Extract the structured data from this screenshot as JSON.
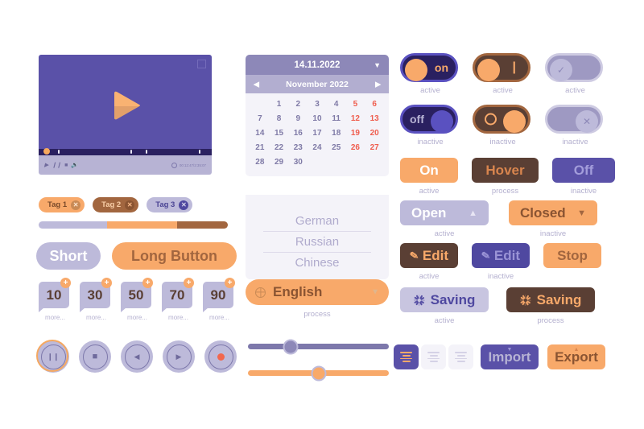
{
  "colors": {
    "orange": "#f8a96a",
    "purple": "#5a51a8",
    "deep_navy": "#2a2060",
    "brown": "#5a3f34",
    "tan": "#a2663f",
    "lavender": "#bdbada",
    "light_bg": "#f4f3f9",
    "red": "#ef5d4e"
  },
  "video_player": {
    "name": "video-player",
    "play_icon": "play-triangle-icon",
    "fullscreen_icon": "fullscreen-icon",
    "controls": [
      "play-icon",
      "pause-icon",
      "stop-icon",
      "volume-icon"
    ],
    "settings_icon": "gear-icon",
    "time": "00:12:47/2:35:07",
    "progress_percent": 4,
    "tick_positions": [
      4,
      18,
      62,
      71,
      96
    ]
  },
  "tags": [
    {
      "label": "Tag 1",
      "close_icon": "close-icon",
      "style": "tag1"
    },
    {
      "label": "Tag 2",
      "close_icon": "close-icon",
      "style": "tag2"
    },
    {
      "label": "Tag 3",
      "close_icon": "close-icon",
      "style": "tag3"
    }
  ],
  "segmented_bar": {
    "name": "segmented-progress-bar",
    "segments": [
      {
        "color": "#bdbada",
        "percent": 36
      },
      {
        "color": "#f8a96a",
        "percent": 37
      },
      {
        "color": "#a2663f",
        "percent": 27
      }
    ]
  },
  "pill_buttons": [
    {
      "label": "Short",
      "style": "pill-short"
    },
    {
      "label": "Long Button",
      "style": "pill-long"
    }
  ],
  "counters": [
    {
      "value": "10",
      "badge": "+",
      "caption": "more..."
    },
    {
      "value": "30",
      "badge": "+",
      "caption": "more..."
    },
    {
      "value": "50",
      "badge": "+",
      "caption": "more..."
    },
    {
      "value": "70",
      "badge": "+",
      "caption": "more..."
    },
    {
      "value": "90",
      "badge": "+",
      "caption": "more..."
    }
  ],
  "media_buttons": [
    {
      "icon": "pause-icon",
      "glyph": "❙❙",
      "highlighted": true
    },
    {
      "icon": "stop-icon",
      "glyph": "■",
      "highlighted": false
    },
    {
      "icon": "rewind-icon",
      "glyph": "◀",
      "highlighted": false
    },
    {
      "icon": "play-icon",
      "glyph": "▶",
      "highlighted": false
    },
    {
      "icon": "record-icon",
      "glyph": "",
      "highlighted": false
    }
  ],
  "calendar": {
    "name": "date-picker",
    "selected_date": "14.11.2022",
    "dropdown_icon": "chevron-down-icon",
    "month_label": "November 2022",
    "prev_icon": "chevron-left-icon",
    "next_icon": "chevron-right-icon",
    "leading_blank_days": 1,
    "days": [
      {
        "n": "1",
        "weekend": false
      },
      {
        "n": "2",
        "weekend": false
      },
      {
        "n": "3",
        "weekend": false
      },
      {
        "n": "4",
        "weekend": false
      },
      {
        "n": "5",
        "weekend": true
      },
      {
        "n": "6",
        "weekend": true
      },
      {
        "n": "7",
        "weekend": false
      },
      {
        "n": "8",
        "weekend": false
      },
      {
        "n": "9",
        "weekend": false
      },
      {
        "n": "10",
        "weekend": false
      },
      {
        "n": "11",
        "weekend": false
      },
      {
        "n": "12",
        "weekend": true
      },
      {
        "n": "13",
        "weekend": true
      },
      {
        "n": "14",
        "weekend": false
      },
      {
        "n": "15",
        "weekend": false
      },
      {
        "n": "16",
        "weekend": false
      },
      {
        "n": "17",
        "weekend": false
      },
      {
        "n": "18",
        "weekend": false
      },
      {
        "n": "19",
        "weekend": true
      },
      {
        "n": "20",
        "weekend": true
      },
      {
        "n": "21",
        "weekend": false
      },
      {
        "n": "22",
        "weekend": false
      },
      {
        "n": "23",
        "weekend": false
      },
      {
        "n": "24",
        "weekend": false
      },
      {
        "n": "25",
        "weekend": false
      },
      {
        "n": "26",
        "weekend": true
      },
      {
        "n": "27",
        "weekend": true
      },
      {
        "n": "28",
        "weekend": false
      },
      {
        "n": "29",
        "weekend": false
      },
      {
        "n": "30",
        "weekend": false
      }
    ]
  },
  "language_select": {
    "name": "language-dropdown",
    "globe_icon": "globe-icon",
    "selected": "English",
    "dropdown_icon": "chevron-down-icon",
    "options": [
      "German",
      "Russian",
      "Chinese"
    ],
    "caption": "process"
  },
  "sliders": [
    {
      "name": "slider-purple",
      "value_percent": 30,
      "track_color": "#7d78ab"
    },
    {
      "name": "slider-orange",
      "value_percent": 50,
      "track_color": "#f8a96a"
    }
  ],
  "toggles": [
    {
      "name": "toggle-on-dark",
      "label": "on",
      "caption": "active",
      "style": "tg-on"
    },
    {
      "name": "toggle-on-brown",
      "label": "|",
      "caption": "active",
      "style": "tg-br-on"
    },
    {
      "name": "toggle-check-gray",
      "label": "",
      "caption": "active",
      "style": "tg-gr",
      "icon": "check-icon"
    },
    {
      "name": "toggle-off-dark",
      "label": "off",
      "caption": "inactive",
      "style": "tg-off"
    },
    {
      "name": "toggle-off-brown",
      "label": "",
      "caption": "inactive",
      "style": "tg-br-off",
      "icon": "circle-icon"
    },
    {
      "name": "toggle-x-gray",
      "label": "",
      "caption": "inactive",
      "style": "tg-gr2",
      "icon": "close-icon"
    }
  ],
  "state_buttons": [
    {
      "name": "button-on",
      "label": "On",
      "caption": "active",
      "style": "b-on"
    },
    {
      "name": "button-hover",
      "label": "Hover",
      "caption": "process",
      "style": "b-hover"
    },
    {
      "name": "button-off",
      "label": "Off",
      "caption": "inactive",
      "style": "b-off"
    }
  ],
  "disclosure_buttons": [
    {
      "name": "button-open",
      "label": "Open",
      "caption": "active",
      "style": "b-open",
      "icon": "chevron-up-icon",
      "glyph": "▲"
    },
    {
      "name": "button-closed",
      "label": "Closed",
      "caption": "inactive",
      "style": "b-closed",
      "icon": "chevron-down-icon",
      "glyph": "▼"
    }
  ],
  "edit_buttons": [
    {
      "name": "button-edit-active",
      "label": "Edit",
      "caption": "active",
      "style": "b-edit-a",
      "icon": "pencil-icon"
    },
    {
      "name": "button-edit-inactive",
      "label": "Edit",
      "caption": "inactive",
      "style": "b-edit-i",
      "icon": "pencil-icon"
    },
    {
      "name": "button-stop",
      "label": "Stop",
      "caption": "",
      "style": "b-stop",
      "icon": ""
    }
  ],
  "saving_buttons": [
    {
      "name": "button-saving-active",
      "label": "Saving",
      "caption": "active",
      "style": "b-save-a",
      "icon": "spinner-icon",
      "spinner_color": "#4f48a0"
    },
    {
      "name": "button-saving-process",
      "label": "Saving",
      "caption": "process",
      "style": "b-save-p",
      "icon": "spinner-icon",
      "spinner_color": "#f8a96a"
    }
  ],
  "align_buttons": [
    {
      "name": "align-left-button",
      "icon": "align-left-icon",
      "style": "al-a",
      "active": true
    },
    {
      "name": "align-center-button",
      "icon": "align-center-icon",
      "style": "al-b",
      "active": false
    },
    {
      "name": "align-right-button",
      "icon": "align-right-icon",
      "style": "al-b",
      "active": false
    }
  ],
  "io_buttons": [
    {
      "name": "import-button",
      "label": "Import",
      "style": "b-import",
      "icon": "arrow-down-icon",
      "glyph": "▼"
    },
    {
      "name": "export-button",
      "label": "Export",
      "style": "b-export",
      "icon": "arrow-up-icon",
      "glyph": "▲"
    }
  ]
}
